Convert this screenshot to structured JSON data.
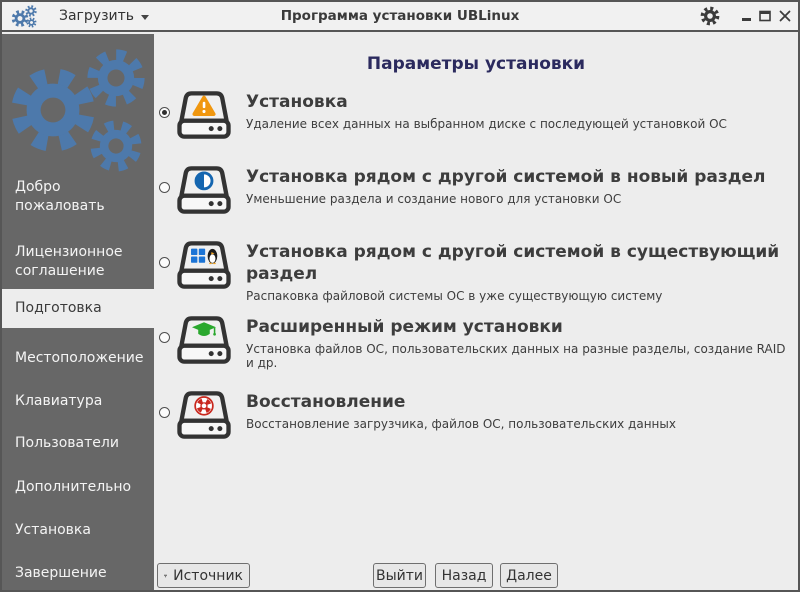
{
  "window": {
    "title": "Программа установки UBLinux",
    "load_button_label": "Загрузить",
    "controls": [
      "minimize",
      "maximize",
      "close"
    ]
  },
  "sidebar": {
    "items": [
      {
        "label": "Добро пожаловать",
        "selected": false
      },
      {
        "label": "Лицензионное соглашение",
        "selected": false
      },
      {
        "label": "Подготовка",
        "selected": true
      },
      {
        "label": "Местоположение",
        "selected": false
      },
      {
        "label": "Клавиатура",
        "selected": false
      },
      {
        "label": "Пользователи",
        "selected": false
      },
      {
        "label": "Дополнительно",
        "selected": false
      },
      {
        "label": "Установка",
        "selected": false
      },
      {
        "label": "Завершение",
        "selected": false
      }
    ]
  },
  "main": {
    "heading": "Параметры установки",
    "options": [
      {
        "title": "Установка",
        "description": "Удаление всех данных на выбранном диске с последующей установкой ОС",
        "icon": "disk-erase-warning-icon",
        "selected": true
      },
      {
        "title": "Установка рядом с другой системой в новый раздел",
        "description": "Уменьшение раздела и создание нового для установки ОС",
        "icon": "disk-shrink-partition-icon",
        "selected": false
      },
      {
        "title": "Установка рядом с другой системой в существующий раздел",
        "description": "Распаковка файловой системы ОС в уже существующую систему",
        "icon": "disk-dualboot-windows-linux-icon",
        "selected": false
      },
      {
        "title": "Расширенный режим установки",
        "description": "Установка файлов ОС, пользовательских данных на разные разделы, создание RAID и др.",
        "icon": "disk-advanced-graduate-icon",
        "selected": false
      },
      {
        "title": "Восстановление",
        "description": "Восстановление загрузчика, файлов ОС, пользовательских данных",
        "icon": "disk-recovery-lifebuoy-icon",
        "selected": false
      }
    ]
  },
  "footer": {
    "source_label": "Источник",
    "exit_label": "Выйти",
    "back_label": "Назад",
    "next_label": "Далее"
  },
  "colors": {
    "accent_blue_gears": "#4d79ab",
    "heading_navy": "#2b2a5e",
    "warning_orange": "#f0970f",
    "partition_blue": "#1566b0",
    "windows_blue": "#1b74d6",
    "advanced_green": "#2aa82e",
    "recovery_red": "#c9281e",
    "sidebar_gray": "#676767",
    "content_gray": "#ededed"
  }
}
